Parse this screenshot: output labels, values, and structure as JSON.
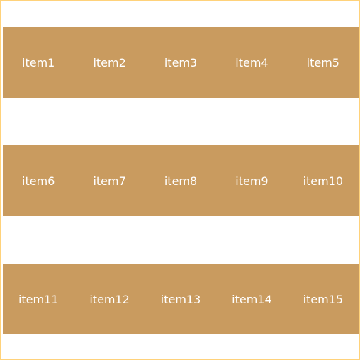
{
  "style": {
    "item_bg": "#c99b5f",
    "border_color": "#ffd27a",
    "text_color": "#ffffff"
  },
  "rows": [
    {
      "items": [
        {
          "label": "item1"
        },
        {
          "label": "item2"
        },
        {
          "label": "item3"
        },
        {
          "label": "item4"
        },
        {
          "label": "item5"
        }
      ]
    },
    {
      "items": [
        {
          "label": "item6"
        },
        {
          "label": "item7"
        },
        {
          "label": "item8"
        },
        {
          "label": "item9"
        },
        {
          "label": "item10"
        }
      ]
    },
    {
      "items": [
        {
          "label": "item11"
        },
        {
          "label": "item12"
        },
        {
          "label": "item13"
        },
        {
          "label": "item14"
        },
        {
          "label": "item15"
        }
      ]
    }
  ]
}
